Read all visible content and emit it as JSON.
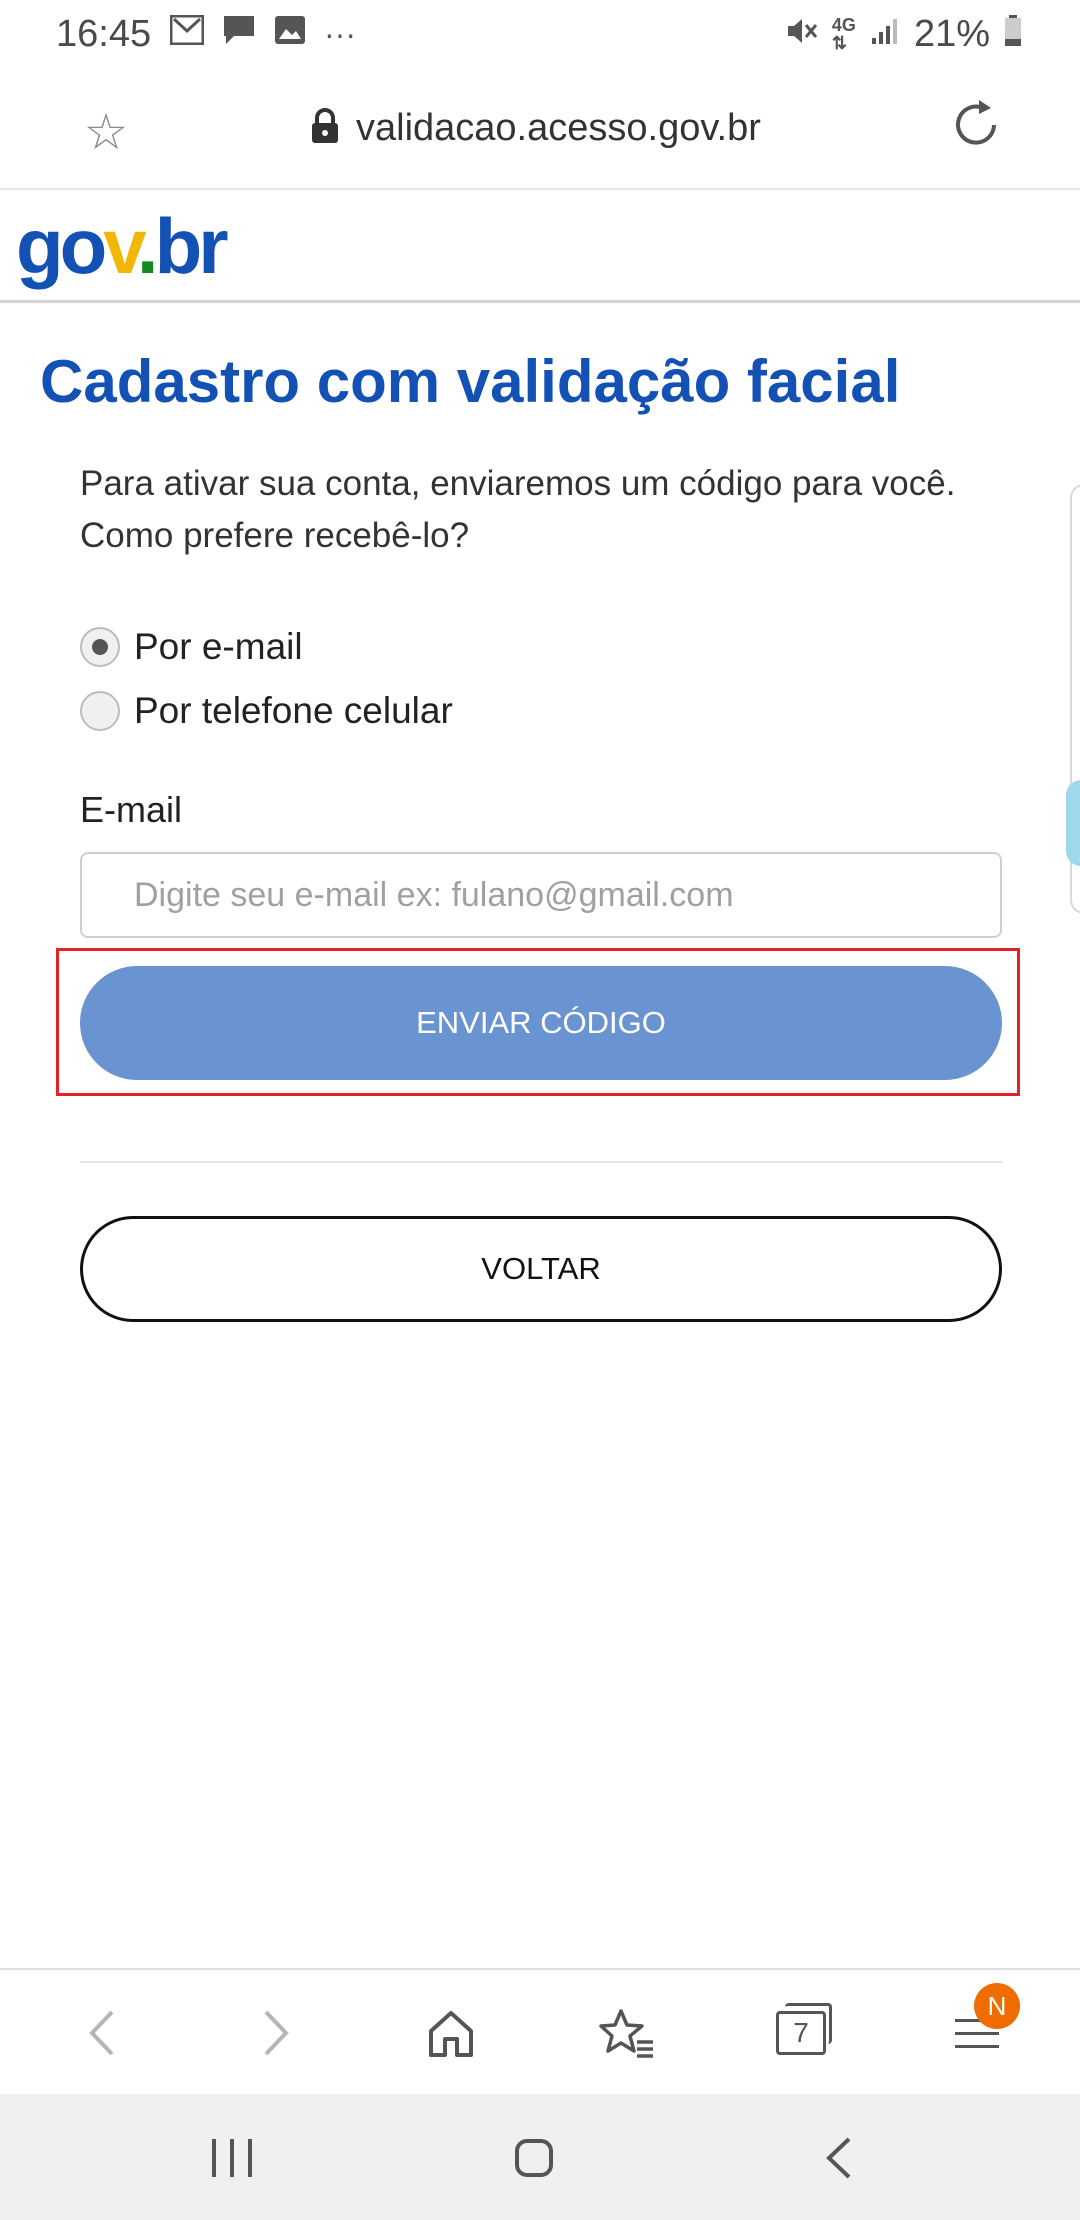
{
  "status_bar": {
    "time": "16:45",
    "left_icons": [
      "gmail-icon",
      "message-icon",
      "image-icon",
      "more-dots-icon"
    ],
    "right_icons": [
      "mute-icon",
      "4g-icon",
      "signal-icon",
      "battery-icon"
    ],
    "battery": "21%"
  },
  "browser": {
    "url": "validacao.acesso.gov.br"
  },
  "site": {
    "logo": {
      "part1": "go",
      "part2": "v",
      "part3": ".",
      "part4": "br"
    }
  },
  "main": {
    "title": "Cadastro com validação facial",
    "intro": "Para ativar sua conta, enviaremos um código para você. Como prefere recebê-lo?",
    "options": [
      {
        "label": "Por e-mail",
        "checked": true
      },
      {
        "label": "Por telefone celular",
        "checked": false
      }
    ],
    "email_label": "E-mail",
    "email_value": "",
    "email_placeholder": "Digite seu e-mail ex: fulano@gmail.com",
    "send_button": "ENVIAR CÓDIGO",
    "back_button": "VOLTAR"
  },
  "toolbar": {
    "tabs_count": "7",
    "notification_badge": "N"
  },
  "colors": {
    "brand_blue": "#1351b4",
    "button_blue": "#6a93d1",
    "highlight_red": "#e0222c",
    "badge_orange": "#ef6c00"
  }
}
